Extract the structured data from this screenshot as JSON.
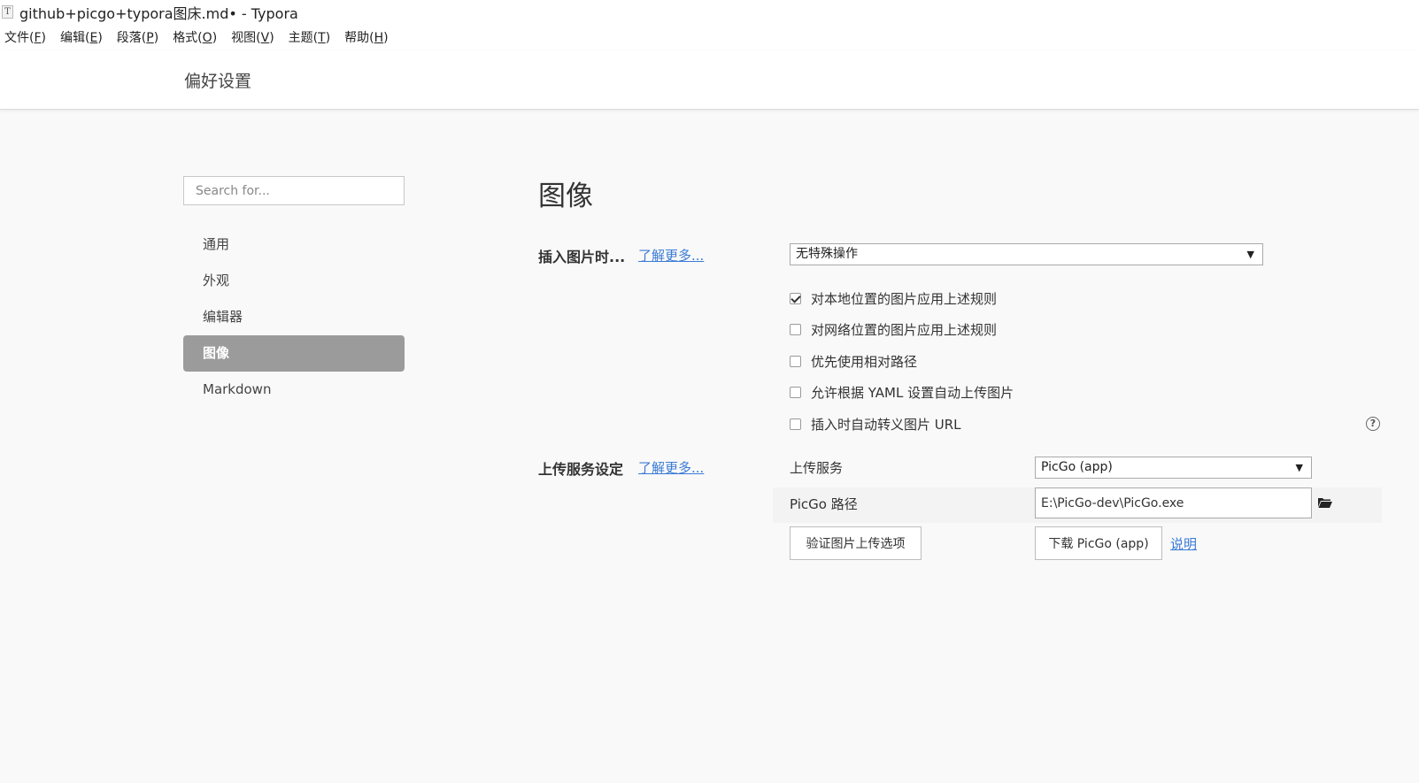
{
  "window": {
    "title": "github+picgo+typora图床.md• - Typora",
    "app_icon": "T"
  },
  "menu": [
    {
      "label": "文件(",
      "mnemonic": "F",
      "suffix": ")"
    },
    {
      "label": "编辑(",
      "mnemonic": "E",
      "suffix": ")"
    },
    {
      "label": "段落(",
      "mnemonic": "P",
      "suffix": ")"
    },
    {
      "label": "格式(",
      "mnemonic": "O",
      "suffix": ")"
    },
    {
      "label": "视图(",
      "mnemonic": "V",
      "suffix": ")"
    },
    {
      "label": "主题(",
      "mnemonic": "T",
      "suffix": ")"
    },
    {
      "label": "帮助(",
      "mnemonic": "H",
      "suffix": ")"
    }
  ],
  "preferences": {
    "title": "偏好设置",
    "search_placeholder": "Search for...",
    "nav": [
      {
        "label": "通用"
      },
      {
        "label": "外观"
      },
      {
        "label": "编辑器"
      },
      {
        "label": "图像",
        "active": true
      },
      {
        "label": "Markdown"
      }
    ]
  },
  "image_section": {
    "title": "图像",
    "insert_label": "插入图片时...",
    "learn_more": "了解更多...",
    "insert_action": "无特殊操作",
    "checkboxes": [
      {
        "label": "对本地位置的图片应用上述规则",
        "checked": true
      },
      {
        "label": "对网络位置的图片应用上述规则",
        "checked": false
      },
      {
        "label": "优先使用相对路径",
        "checked": false
      },
      {
        "label": "允许根据 YAML 设置自动上传图片",
        "checked": false
      },
      {
        "label": "插入时自动转义图片 URL",
        "checked": false
      }
    ],
    "help_icon": "?"
  },
  "upload_section": {
    "label": "上传服务设定",
    "learn_more": "了解更多...",
    "service_label": "上传服务",
    "service_value": "PicGo (app)",
    "path_label": "PicGo 路径",
    "path_value": "E:\\PicGo-dev\\PicGo.exe",
    "verify_button": "验证图片上传选项",
    "download_button": "下载 PicGo (app)",
    "doc_link": "说明"
  },
  "colors": {
    "accent_link": "#3a7bd5",
    "nav_active_bg": "#9b9b9b",
    "page_bg": "#f9f9f9"
  }
}
